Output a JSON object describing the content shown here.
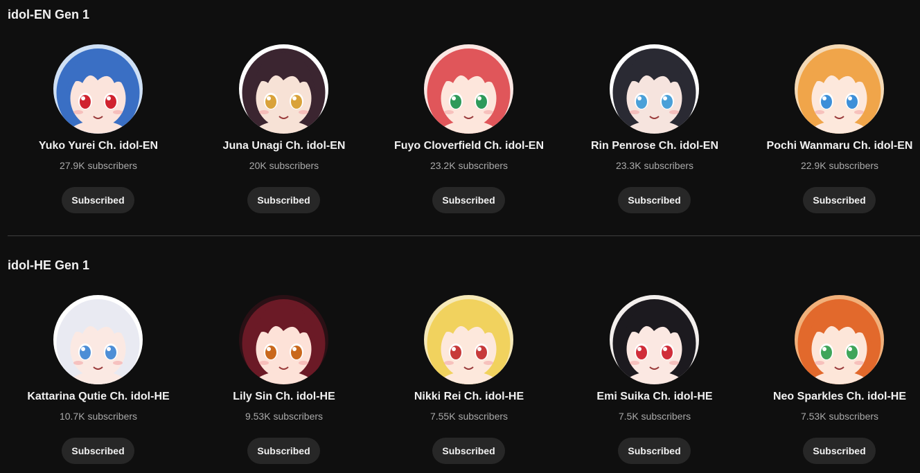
{
  "sections": [
    {
      "title": "idol-EN Gen 1",
      "channels": [
        {
          "name": "Yuko Yurei Ch. idol-EN",
          "subscribers": "27.9K subscribers",
          "button": "Subscribed",
          "avatar_icon": "avatar-blue-hair-red-eyes",
          "hair": "#3a6fc4",
          "skin": "#fbe4dc",
          "eyes": "#d0232f",
          "bg": "#cfe0f5"
        },
        {
          "name": "Juna Unagi Ch. idol-EN",
          "subscribers": "20K subscribers",
          "button": "Subscribed",
          "avatar_icon": "avatar-dark-hair-gold-eyes",
          "hair": "#3b2530",
          "skin": "#f7e2d6",
          "eyes": "#d9a23a",
          "bg": "#ffffff"
        },
        {
          "name": "Fuyo Cloverfield Ch. idol-EN",
          "subscribers": "23.2K subscribers",
          "button": "Subscribed",
          "avatar_icon": "avatar-red-hair-green-eyes",
          "hair": "#e0565a",
          "skin": "#fde6dc",
          "eyes": "#2e9a5a",
          "bg": "#fbe7e3"
        },
        {
          "name": "Rin Penrose Ch. idol-EN",
          "subscribers": "23.3K subscribers",
          "button": "Subscribed",
          "avatar_icon": "avatar-black-white-hair",
          "hair": "#2a2a33",
          "skin": "#f6e4de",
          "eyes": "#4aa0d8",
          "bg": "#ffffff"
        },
        {
          "name": "Pochi Wanmaru Ch. idol-EN",
          "subscribers": "22.9K subscribers",
          "button": "Subscribed",
          "avatar_icon": "avatar-orange-hair-blue-eyes",
          "hair": "#f0a54a",
          "skin": "#fde8dc",
          "eyes": "#3d8fd8",
          "bg": "#f4d9b5"
        }
      ]
    },
    {
      "title": "idol-HE Gen 1",
      "channels": [
        {
          "name": "Kattarina Qutie Ch. idol-HE",
          "subscribers": "10.7K subscribers",
          "button": "Subscribed",
          "avatar_icon": "avatar-white-hair-blue-eyes",
          "hair": "#e9eaf2",
          "skin": "#fbe9e3",
          "eyes": "#4d8ed6",
          "bg": "#ffffff"
        },
        {
          "name": "Lily Sin Ch. idol-HE",
          "subscribers": "9.53K subscribers",
          "button": "Subscribed",
          "avatar_icon": "avatar-crimson-hair-amber-eyes",
          "hair": "#6b1a26",
          "skin": "#fde2d8",
          "eyes": "#c9681c",
          "bg": "#2a1015"
        },
        {
          "name": "Nikki Rei Ch. idol-HE",
          "subscribers": "7.55K subscribers",
          "button": "Subscribed",
          "avatar_icon": "avatar-blonde-hair-red-eyes",
          "hair": "#f1d25e",
          "skin": "#fde8dc",
          "eyes": "#c73a3a",
          "bg": "#f6e9b8"
        },
        {
          "name": "Emi Suika Ch. idol-HE",
          "subscribers": "7.5K subscribers",
          "button": "Subscribed",
          "avatar_icon": "avatar-black-hair-red-eyes",
          "hair": "#1c1a1f",
          "skin": "#fbe8e2",
          "eyes": "#d02d3a",
          "bg": "#f3efed"
        },
        {
          "name": "Neo Sparkles Ch. idol-HE",
          "subscribers": "7.53K subscribers",
          "button": "Subscribed",
          "avatar_icon": "avatar-ginger-hair-green-eyes",
          "hair": "#e2692c",
          "skin": "#fde6d9",
          "eyes": "#3fa55a",
          "bg": "#f1b07a"
        }
      ]
    }
  ]
}
